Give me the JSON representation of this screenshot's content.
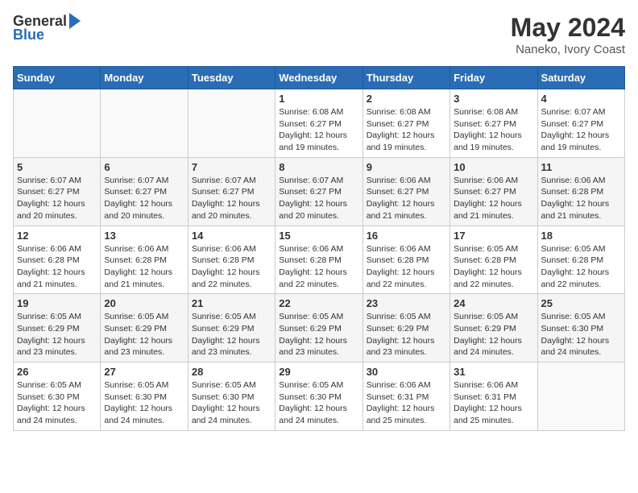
{
  "header": {
    "logo_general": "General",
    "logo_blue": "Blue",
    "month_year": "May 2024",
    "location": "Naneko, Ivory Coast"
  },
  "calendar": {
    "days_of_week": [
      "Sunday",
      "Monday",
      "Tuesday",
      "Wednesday",
      "Thursday",
      "Friday",
      "Saturday"
    ],
    "weeks": [
      [
        {
          "day": "",
          "info": ""
        },
        {
          "day": "",
          "info": ""
        },
        {
          "day": "",
          "info": ""
        },
        {
          "day": "1",
          "info": "Sunrise: 6:08 AM\nSunset: 6:27 PM\nDaylight: 12 hours\nand 19 minutes."
        },
        {
          "day": "2",
          "info": "Sunrise: 6:08 AM\nSunset: 6:27 PM\nDaylight: 12 hours\nand 19 minutes."
        },
        {
          "day": "3",
          "info": "Sunrise: 6:08 AM\nSunset: 6:27 PM\nDaylight: 12 hours\nand 19 minutes."
        },
        {
          "day": "4",
          "info": "Sunrise: 6:07 AM\nSunset: 6:27 PM\nDaylight: 12 hours\nand 19 minutes."
        }
      ],
      [
        {
          "day": "5",
          "info": "Sunrise: 6:07 AM\nSunset: 6:27 PM\nDaylight: 12 hours\nand 20 minutes."
        },
        {
          "day": "6",
          "info": "Sunrise: 6:07 AM\nSunset: 6:27 PM\nDaylight: 12 hours\nand 20 minutes."
        },
        {
          "day": "7",
          "info": "Sunrise: 6:07 AM\nSunset: 6:27 PM\nDaylight: 12 hours\nand 20 minutes."
        },
        {
          "day": "8",
          "info": "Sunrise: 6:07 AM\nSunset: 6:27 PM\nDaylight: 12 hours\nand 20 minutes."
        },
        {
          "day": "9",
          "info": "Sunrise: 6:06 AM\nSunset: 6:27 PM\nDaylight: 12 hours\nand 21 minutes."
        },
        {
          "day": "10",
          "info": "Sunrise: 6:06 AM\nSunset: 6:27 PM\nDaylight: 12 hours\nand 21 minutes."
        },
        {
          "day": "11",
          "info": "Sunrise: 6:06 AM\nSunset: 6:28 PM\nDaylight: 12 hours\nand 21 minutes."
        }
      ],
      [
        {
          "day": "12",
          "info": "Sunrise: 6:06 AM\nSunset: 6:28 PM\nDaylight: 12 hours\nand 21 minutes."
        },
        {
          "day": "13",
          "info": "Sunrise: 6:06 AM\nSunset: 6:28 PM\nDaylight: 12 hours\nand 21 minutes."
        },
        {
          "day": "14",
          "info": "Sunrise: 6:06 AM\nSunset: 6:28 PM\nDaylight: 12 hours\nand 22 minutes."
        },
        {
          "day": "15",
          "info": "Sunrise: 6:06 AM\nSunset: 6:28 PM\nDaylight: 12 hours\nand 22 minutes."
        },
        {
          "day": "16",
          "info": "Sunrise: 6:06 AM\nSunset: 6:28 PM\nDaylight: 12 hours\nand 22 minutes."
        },
        {
          "day": "17",
          "info": "Sunrise: 6:05 AM\nSunset: 6:28 PM\nDaylight: 12 hours\nand 22 minutes."
        },
        {
          "day": "18",
          "info": "Sunrise: 6:05 AM\nSunset: 6:28 PM\nDaylight: 12 hours\nand 22 minutes."
        }
      ],
      [
        {
          "day": "19",
          "info": "Sunrise: 6:05 AM\nSunset: 6:29 PM\nDaylight: 12 hours\nand 23 minutes."
        },
        {
          "day": "20",
          "info": "Sunrise: 6:05 AM\nSunset: 6:29 PM\nDaylight: 12 hours\nand 23 minutes."
        },
        {
          "day": "21",
          "info": "Sunrise: 6:05 AM\nSunset: 6:29 PM\nDaylight: 12 hours\nand 23 minutes."
        },
        {
          "day": "22",
          "info": "Sunrise: 6:05 AM\nSunset: 6:29 PM\nDaylight: 12 hours\nand 23 minutes."
        },
        {
          "day": "23",
          "info": "Sunrise: 6:05 AM\nSunset: 6:29 PM\nDaylight: 12 hours\nand 23 minutes."
        },
        {
          "day": "24",
          "info": "Sunrise: 6:05 AM\nSunset: 6:29 PM\nDaylight: 12 hours\nand 24 minutes."
        },
        {
          "day": "25",
          "info": "Sunrise: 6:05 AM\nSunset: 6:30 PM\nDaylight: 12 hours\nand 24 minutes."
        }
      ],
      [
        {
          "day": "26",
          "info": "Sunrise: 6:05 AM\nSunset: 6:30 PM\nDaylight: 12 hours\nand 24 minutes."
        },
        {
          "day": "27",
          "info": "Sunrise: 6:05 AM\nSunset: 6:30 PM\nDaylight: 12 hours\nand 24 minutes."
        },
        {
          "day": "28",
          "info": "Sunrise: 6:05 AM\nSunset: 6:30 PM\nDaylight: 12 hours\nand 24 minutes."
        },
        {
          "day": "29",
          "info": "Sunrise: 6:05 AM\nSunset: 6:30 PM\nDaylight: 12 hours\nand 24 minutes."
        },
        {
          "day": "30",
          "info": "Sunrise: 6:06 AM\nSunset: 6:31 PM\nDaylight: 12 hours\nand 25 minutes."
        },
        {
          "day": "31",
          "info": "Sunrise: 6:06 AM\nSunset: 6:31 PM\nDaylight: 12 hours\nand 25 minutes."
        },
        {
          "day": "",
          "info": ""
        }
      ]
    ]
  }
}
